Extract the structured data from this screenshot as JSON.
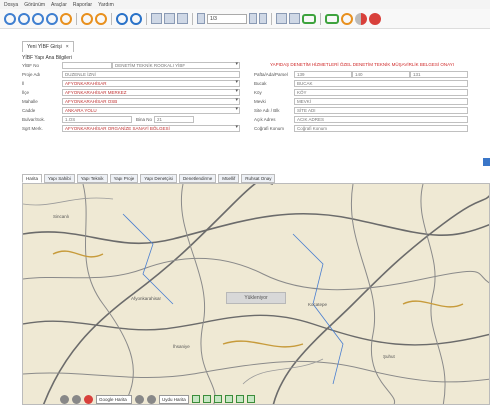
{
  "menubar": {
    "items": [
      "Dosya",
      "Görünüm",
      "Araçlar",
      "Raporlar",
      "Yardım"
    ]
  },
  "toolbar": {
    "page_field": "1/3"
  },
  "doc_tab": {
    "label": "Yeni YİBF Girişi",
    "close": "×"
  },
  "panel_title": "YİBF Yapı Ana Bilgileri",
  "form": {
    "red_title": "YAPIDAŞ DENETİM HİZMETLERİ ÖZEL DENETİM TEKNİK MÜŞAVİRLİK BELGESİ ONAYI",
    "left_rows": [
      {
        "label": "YİBF No",
        "value": "",
        "value2": "DENETİM TEKNİK ROOKALI YİBF"
      },
      {
        "label": "Proje Adı",
        "value": "DUZENLE İZNİ"
      },
      {
        "label": "İl",
        "value": "AFYONKARAHİSAR"
      },
      {
        "label": "İlçe",
        "value": "AFYONKARAHİSAR MERKEZ"
      },
      {
        "label": "Mahalle",
        "value": "AFYONKARAHİSAR OSB"
      },
      {
        "label": "Cadde",
        "value": "ANKARA YOLU"
      },
      {
        "label": "Bulvar/Sok.",
        "value": "1.OS",
        "label2": "Bina No",
        "value2": "21"
      },
      {
        "label": "Sgrt Merk.",
        "value": "AFYONKARAHİSAR ORGANİZE SANAYİ BÖLGESİ"
      }
    ],
    "right_rows": [
      {
        "label": "Pafta/Ada/Parsel",
        "v1": "139",
        "v2": "140",
        "v3": "131"
      },
      {
        "label": "Bucak",
        "value": "BUCAK"
      },
      {
        "label": "Köy",
        "value": "KÖY"
      },
      {
        "label": "Mevki",
        "value": "MEVKİ"
      },
      {
        "label": "Site Adı / Blk",
        "value": "SİTE ADI"
      },
      {
        "label": "Açık Adres",
        "value": "ACIK ADRES"
      },
      {
        "label": "Coğrafi Konum",
        "value": "Coğrafi Konum"
      }
    ]
  },
  "tabs": [
    "Harita",
    "Yapı Sahibi",
    "Yapı Teknik",
    "Yapı Proje",
    "Yapı Denetçisi",
    "Denetlendirme",
    "Müellif",
    "Ruhsat Onay"
  ],
  "map": {
    "loading_text": "Yükleniyor",
    "labels": [
      "Sincanlı",
      "Afyonkarahisar",
      "İhsaniye",
      "Kocatepe",
      "Şuhut"
    ]
  },
  "mapbar": {
    "select_value": "Google Harita",
    "layer_select": "Uydu Harita"
  },
  "colors": {
    "accent": "#3a76c8",
    "red": "#d02a2a",
    "map_bg": "#efe9d4"
  }
}
